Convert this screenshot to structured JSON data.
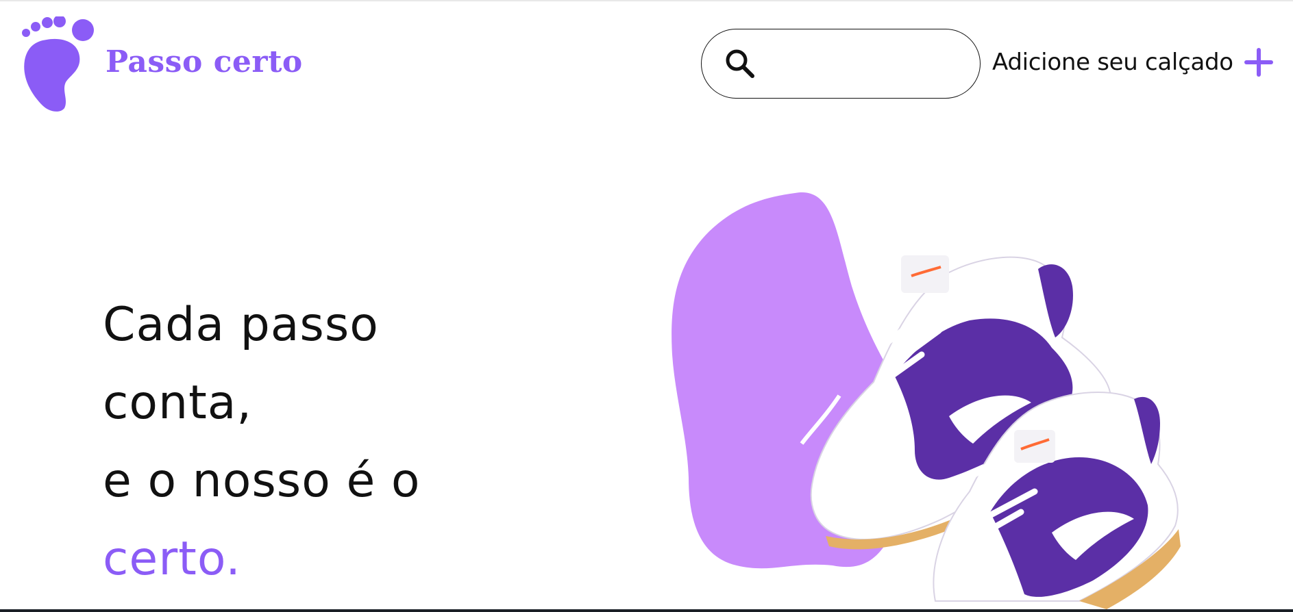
{
  "colors": {
    "brand": "#8b5cf6",
    "blob": "#c88afb",
    "text": "#111111",
    "shoe_purple": "#5b2fa6"
  },
  "header": {
    "brand_name": "Passo certo",
    "logo_icon": "footprint-icon",
    "search": {
      "icon": "search-icon",
      "placeholder": "",
      "value": ""
    },
    "add_shoe": {
      "label": "Adicione seu calçado",
      "icon": "plus-icon"
    }
  },
  "hero": {
    "lines": [
      "Cada passo",
      "conta,",
      "e o nosso é o"
    ],
    "accent": "certo.",
    "image": "purple-sneakers-image"
  }
}
